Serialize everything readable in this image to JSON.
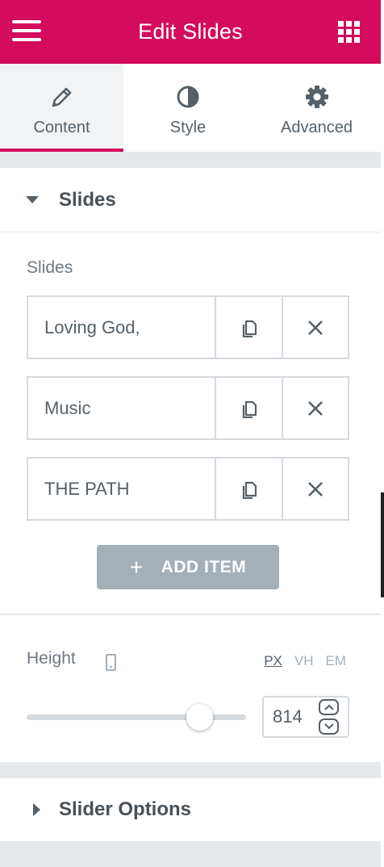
{
  "header": {
    "title": "Edit Slides"
  },
  "tabs": [
    {
      "label": "Content",
      "icon": "pencil-icon",
      "active": true
    },
    {
      "label": "Style",
      "icon": "half-circle-icon"
    },
    {
      "label": "Advanced",
      "icon": "gear-icon"
    }
  ],
  "slides_section": {
    "title": "Slides",
    "field_label": "Slides",
    "items": [
      {
        "title": "Loving God,"
      },
      {
        "title": "Music"
      },
      {
        "title": "THE PATH"
      }
    ],
    "add_item_label": "ADD ITEM",
    "add_item_icon": "+"
  },
  "height_control": {
    "label": "Height",
    "units": [
      "PX",
      "VH",
      "EM"
    ],
    "active_unit": "PX",
    "value": "814",
    "slider_fraction": 0.79
  },
  "slider_options": {
    "title": "Slider Options"
  },
  "colors": {
    "brand": "#d30c5c",
    "button_gray": "#a4afb7",
    "text": "#556068"
  }
}
